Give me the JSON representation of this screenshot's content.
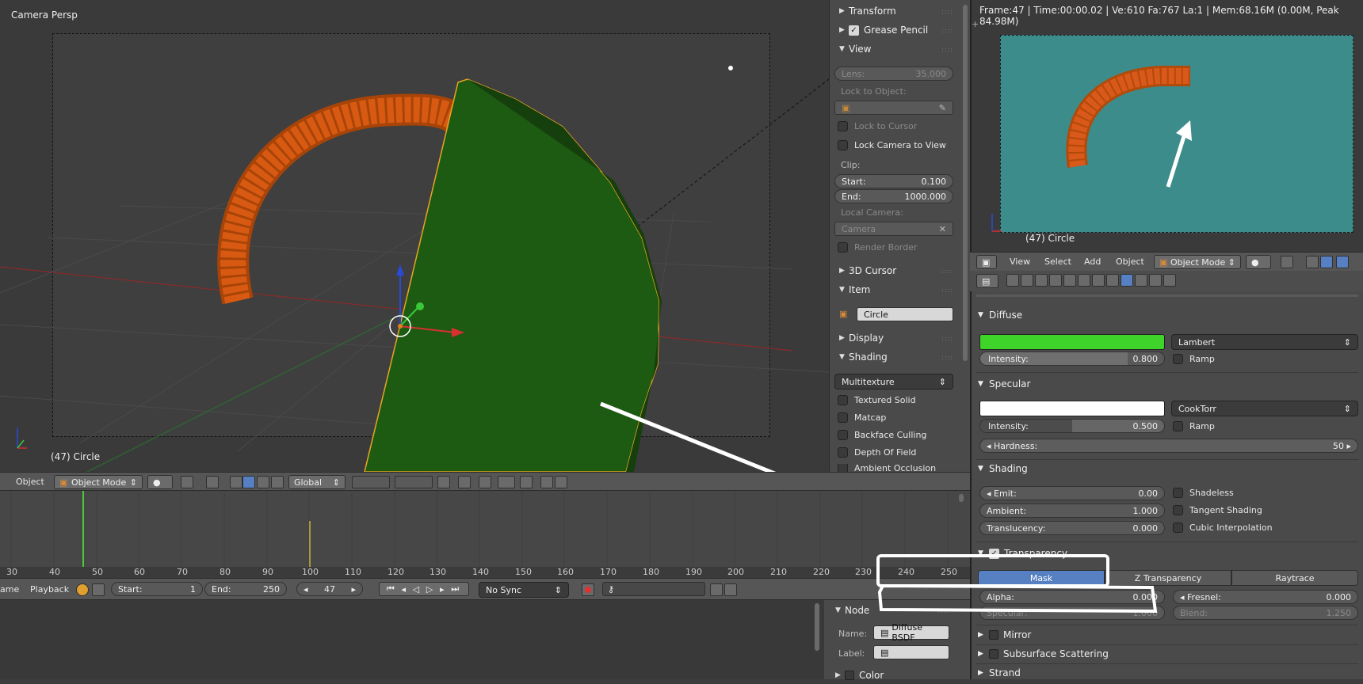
{
  "viewport": {
    "mode_label": "Camera Persp",
    "object_label": "(47) Circle"
  },
  "npanel": {
    "sections": {
      "transform": "Transform",
      "grease_pencil": "Grease Pencil",
      "view": "View",
      "cursor3d": "3D Cursor",
      "item": "Item",
      "display": "Display",
      "shading": "Shading"
    },
    "lens_label": "Lens:",
    "lens_value": "35.000",
    "lock_to_object": "Lock to Object:",
    "lock_to_cursor": "Lock to Cursor",
    "lock_camera_to_view": "Lock Camera to View",
    "clip_label": "Clip:",
    "clip_start_label": "Start:",
    "clip_start_value": "0.100",
    "clip_end_label": "End:",
    "clip_end_value": "1000.000",
    "local_camera_label": "Local Camera:",
    "local_camera_value": "Camera",
    "render_border": "Render Border",
    "item_name": "Circle",
    "shading_mode": "Multitexture",
    "textured_solid": "Textured Solid",
    "matcap": "Matcap",
    "backface_culling": "Backface Culling",
    "depth_of_field": "Depth Of Field",
    "ambient_occlusion": "Ambient Occlusion"
  },
  "vpheader": {
    "object_menu": "Object",
    "mode": "Object Mode",
    "orientation": "Global"
  },
  "timeline": {
    "ticks": [
      "30",
      "40",
      "50",
      "60",
      "70",
      "80",
      "90",
      "100",
      "110",
      "120",
      "130",
      "140",
      "150",
      "160",
      "170",
      "180",
      "190",
      "200",
      "210",
      "220",
      "230",
      "240",
      "250"
    ],
    "menu_frame": "ame",
    "menu_playback": "Playback",
    "start_label": "Start:",
    "start_value": "1",
    "end_label": "End:",
    "end_value": "250",
    "current_frame": "47",
    "sync": "No Sync"
  },
  "node_panel": {
    "title": "Node",
    "name_label": "Name:",
    "name_value": "Diffuse BSDF",
    "label_label": "Label:",
    "color_section": "Color"
  },
  "render_view": {
    "info": "Frame:47 | Time:00:00.02 | Ve:610 Fa:767 La:1 | Mem:68.16M (0.00M, Peak 84.98M)",
    "object_label": "(47) Circle",
    "header": {
      "view": "View",
      "select": "Select",
      "add": "Add",
      "object": "Object",
      "mode": "Object Mode"
    }
  },
  "material": {
    "diffuse_title": "Diffuse",
    "diffuse_color": "#3fd42a",
    "diffuse_shader": "Lambert",
    "diffuse_intensity_label": "Intensity:",
    "diffuse_intensity_value": "0.800",
    "ramp_label": "Ramp",
    "specular_title": "Specular",
    "specular_color": "#ffffff",
    "specular_shader": "CookTorr",
    "specular_intensity_label": "Intensity:",
    "specular_intensity_value": "0.500",
    "specular_intensity_fraction": 0.5,
    "hardness_label": "Hardness:",
    "hardness_value": "50",
    "shading_title": "Shading",
    "emit_label": "Emit:",
    "emit_value": "0.00",
    "shadeless": "Shadeless",
    "ambient_label": "Ambient:",
    "ambient_value": "1.000",
    "tangent_shading": "Tangent Shading",
    "translucency_label": "Translucency:",
    "translucency_value": "0.000",
    "cubic_interpolation": "Cubic Interpolation",
    "transparency_title": "Transparency",
    "transparency_modes": [
      "Mask",
      "Z Transparency",
      "Raytrace"
    ],
    "alpha_label": "Alpha:",
    "alpha_value": "0.000",
    "fresnel_label": "Fresnel:",
    "fresnel_value": "0.000",
    "specular_t_label": "Specular:",
    "specular_t_value": "1.000",
    "blend_label": "Blend:",
    "blend_value": "1.250",
    "mirror_title": "Mirror",
    "sss_title": "Subsurface Scattering",
    "strand_title": "Strand"
  }
}
